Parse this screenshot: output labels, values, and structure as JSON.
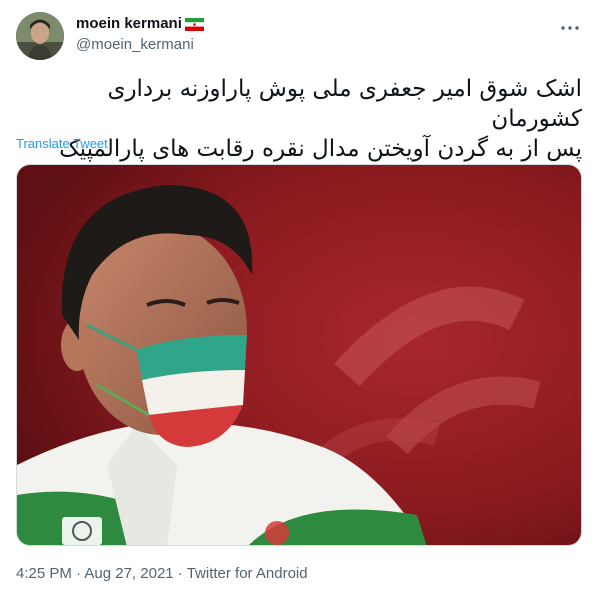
{
  "user": {
    "display_name": "moein kermani",
    "handle": "@moein_kermani",
    "flag_icon": "iran-flag-icon",
    "avatar_icon": "profile-avatar"
  },
  "tweet": {
    "text_line1": "اشک شوق امیر جعفری ملی پوش پاراوزنه برداری کشورمان",
    "text_line2": "پس از به گردن آویختن مدال نقره رقابت های پارالمپیک توکیو",
    "translate_label": "Translate Tweet",
    "time": "4:25 PM",
    "date": "Aug 27, 2021",
    "source": "Twitter for Android",
    "separator": " · "
  },
  "colors": {
    "link": "#1d9bf0",
    "secondary_text": "#536471",
    "primary_text": "#0f1419",
    "photo_background": "#8a1a1f"
  },
  "photo": {
    "description_icon": "athlete-photo"
  }
}
